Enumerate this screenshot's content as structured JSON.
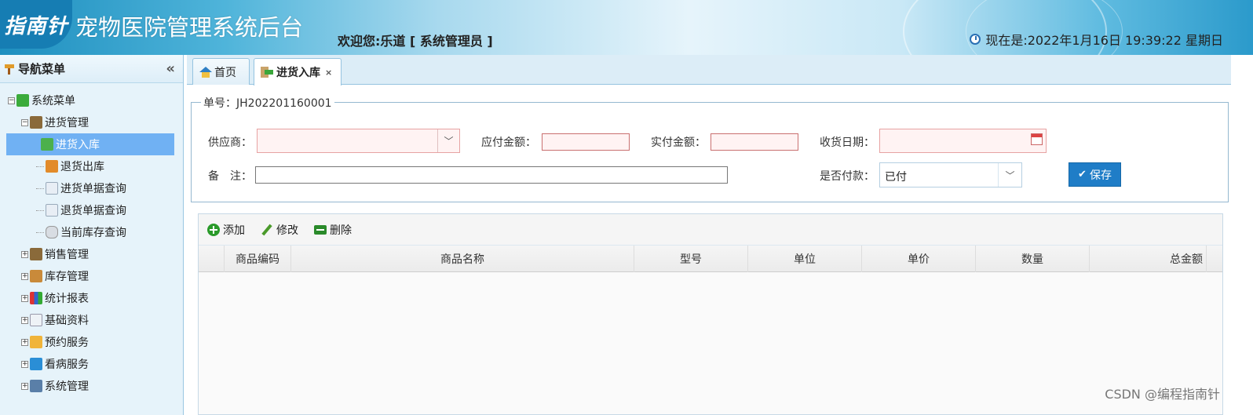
{
  "header": {
    "logo_text": "指南针",
    "app_title": "宠物医院管理系统后台",
    "welcome": "欢迎您:乐道 [ 系统管理员 ]",
    "clock": "现在是:2022年1月16日 19:39:22 星期日"
  },
  "sidebar": {
    "title": "导航菜单",
    "collapse": "«",
    "root": "系统菜单",
    "items": [
      {
        "label": "进货管理",
        "expanded": true,
        "children": [
          {
            "label": "进货入库",
            "selected": true
          },
          {
            "label": "退货出库"
          },
          {
            "label": "进货单据查询"
          },
          {
            "label": "退货单据查询"
          },
          {
            "label": "当前库存查询"
          }
        ]
      },
      {
        "label": "销售管理"
      },
      {
        "label": "库存管理"
      },
      {
        "label": "统计报表"
      },
      {
        "label": "基础资料"
      },
      {
        "label": "预约服务"
      },
      {
        "label": "看病服务"
      },
      {
        "label": "系统管理"
      }
    ]
  },
  "tabs": [
    {
      "label": "首页"
    },
    {
      "label": "进货入库",
      "close": "×"
    }
  ],
  "form": {
    "order_no": "单号：JH202201160001",
    "supplier_label": "供应商：",
    "payable_label": "应付金额：",
    "paid_label": "实付金额：",
    "receive_date_label": "收货日期：",
    "remark_label": "备　注：",
    "is_paid_label": "是否付款：",
    "is_paid_value": "已付",
    "save_label": "保存"
  },
  "grid": {
    "toolbar": {
      "add": "添加",
      "edit": "修改",
      "delete": "删除"
    },
    "columns": [
      "商品编码",
      "商品名称",
      "型号",
      "单位",
      "单价",
      "数量",
      "总金额"
    ],
    "rows": []
  },
  "watermark": "CSDN @编程指南针"
}
